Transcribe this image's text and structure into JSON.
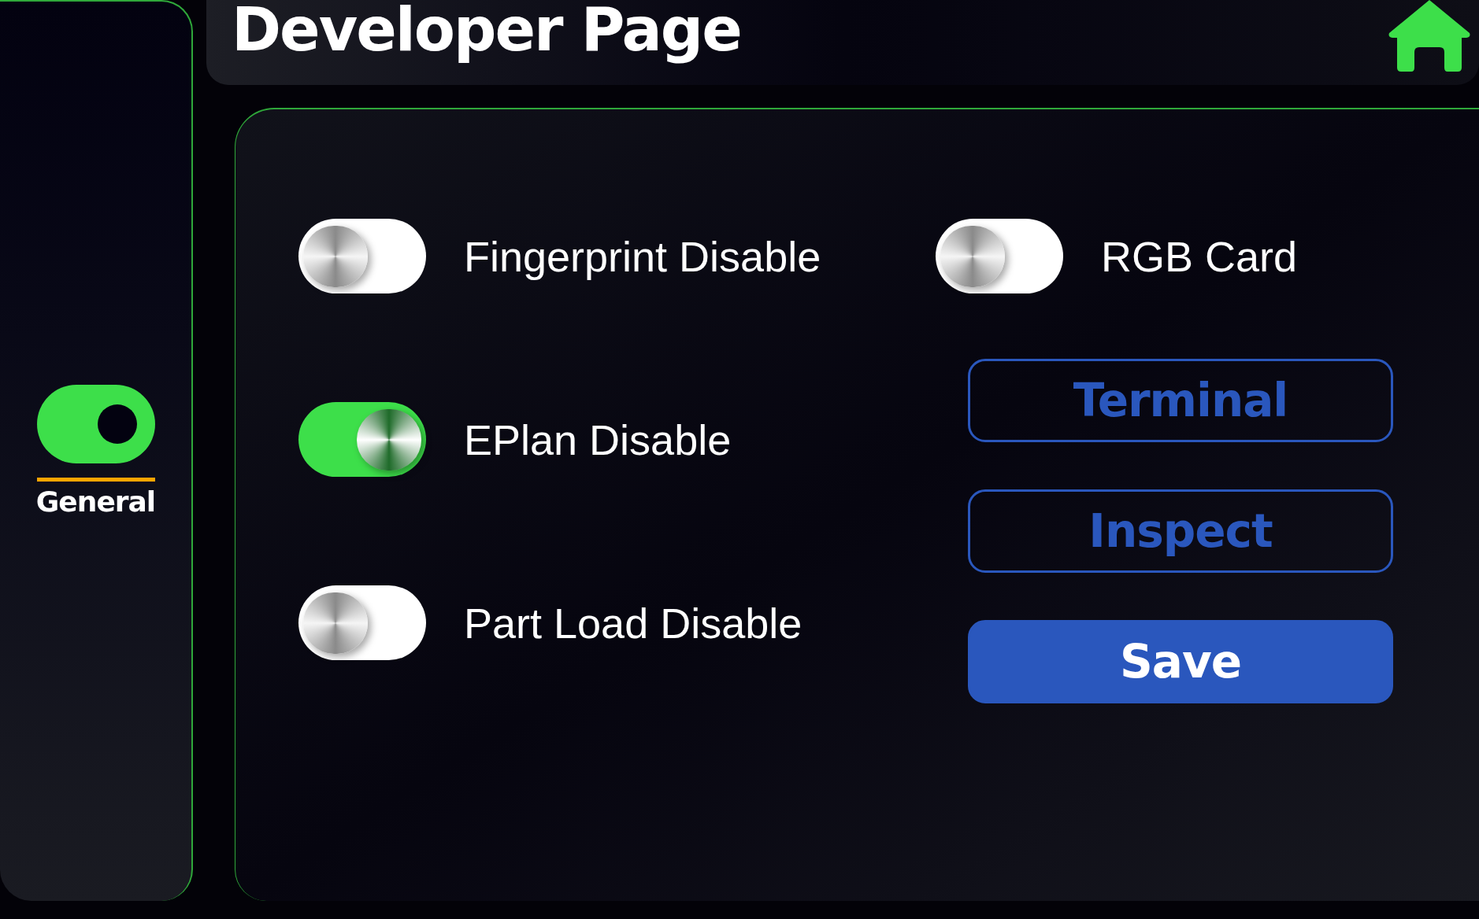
{
  "sidebar": {
    "items": [
      {
        "label": "General",
        "selected": true
      }
    ]
  },
  "header": {
    "title": "Developer Page"
  },
  "left_column": {
    "toggles": [
      {
        "label": "Fingerprint Disable",
        "on": false
      },
      {
        "label": "EPlan Disable",
        "on": true
      },
      {
        "label": "Part Load Disable",
        "on": false
      }
    ]
  },
  "right_column": {
    "toggles": [
      {
        "label": "RGB Card",
        "on": false
      }
    ],
    "buttons": [
      {
        "label": "Terminal",
        "kind": "outline"
      },
      {
        "label": "Inspect",
        "kind": "outline"
      },
      {
        "label": "Save",
        "kind": "primary"
      }
    ]
  }
}
